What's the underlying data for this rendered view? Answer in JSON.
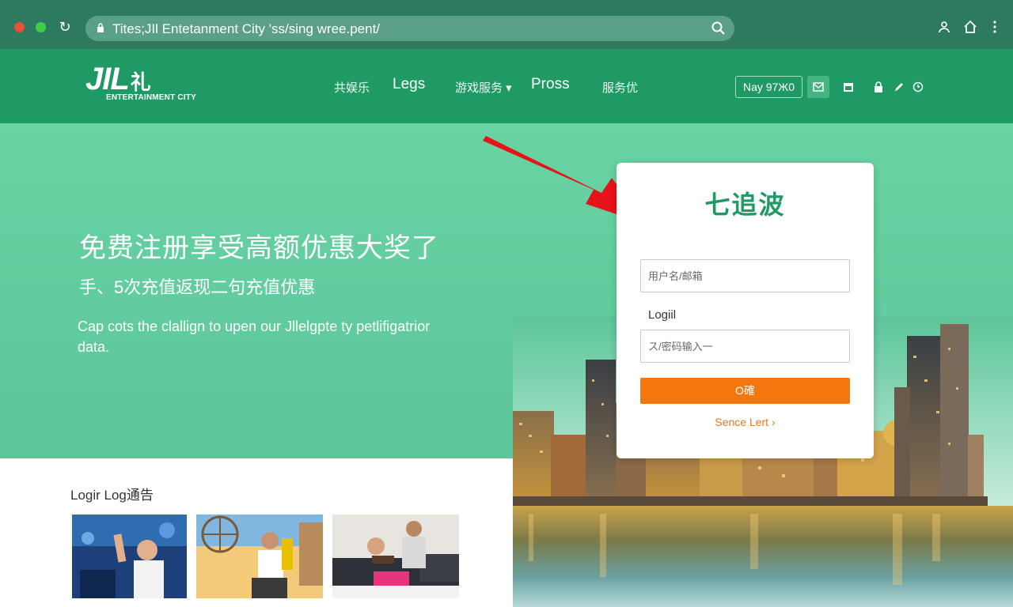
{
  "browser": {
    "url": "Tites;JIl Entetanment City 'ss/sing wree.pent/",
    "reload_icon": "reload-icon",
    "lock_icon": "lock-icon",
    "search_icon": "search-icon",
    "right_icons": [
      "profile-icon",
      "home-icon",
      "menu-dots-icon"
    ]
  },
  "header": {
    "logo_main": "JIL",
    "logo_mark": "礼",
    "logo_sub": "ENTERTAINMENT CITY",
    "nav": [
      "共娱乐",
      "Legs",
      "游戏服务 ▾",
      "Pross",
      "服务优"
    ],
    "date": "Nay 97Ж0",
    "icons": [
      "mail-icon",
      "calendar-icon",
      "user-icon",
      "edit-icon",
      "clock-icon"
    ]
  },
  "hero": {
    "title": "免费注册享受高额优惠大奖了",
    "subtitle": "手、5次充值返现二句充值优惠",
    "description": "Cap cots the clallign to upen our Jllelgpte ty petlifigatrior data."
  },
  "login": {
    "title": "七追波",
    "username_placeholder": "用户名/邮箱",
    "password_label": "Logiil",
    "password_placeholder": "ス/密码输入一",
    "submit": "O確",
    "link": "Sence Lert ›"
  },
  "bottom": {
    "heading": "Logir Log通告"
  },
  "colors": {
    "chrome": "#2d7a5f",
    "header": "#1f9a64",
    "hero": "#62cd9f",
    "button": "#f4760f",
    "arrow": "#e8121a"
  }
}
